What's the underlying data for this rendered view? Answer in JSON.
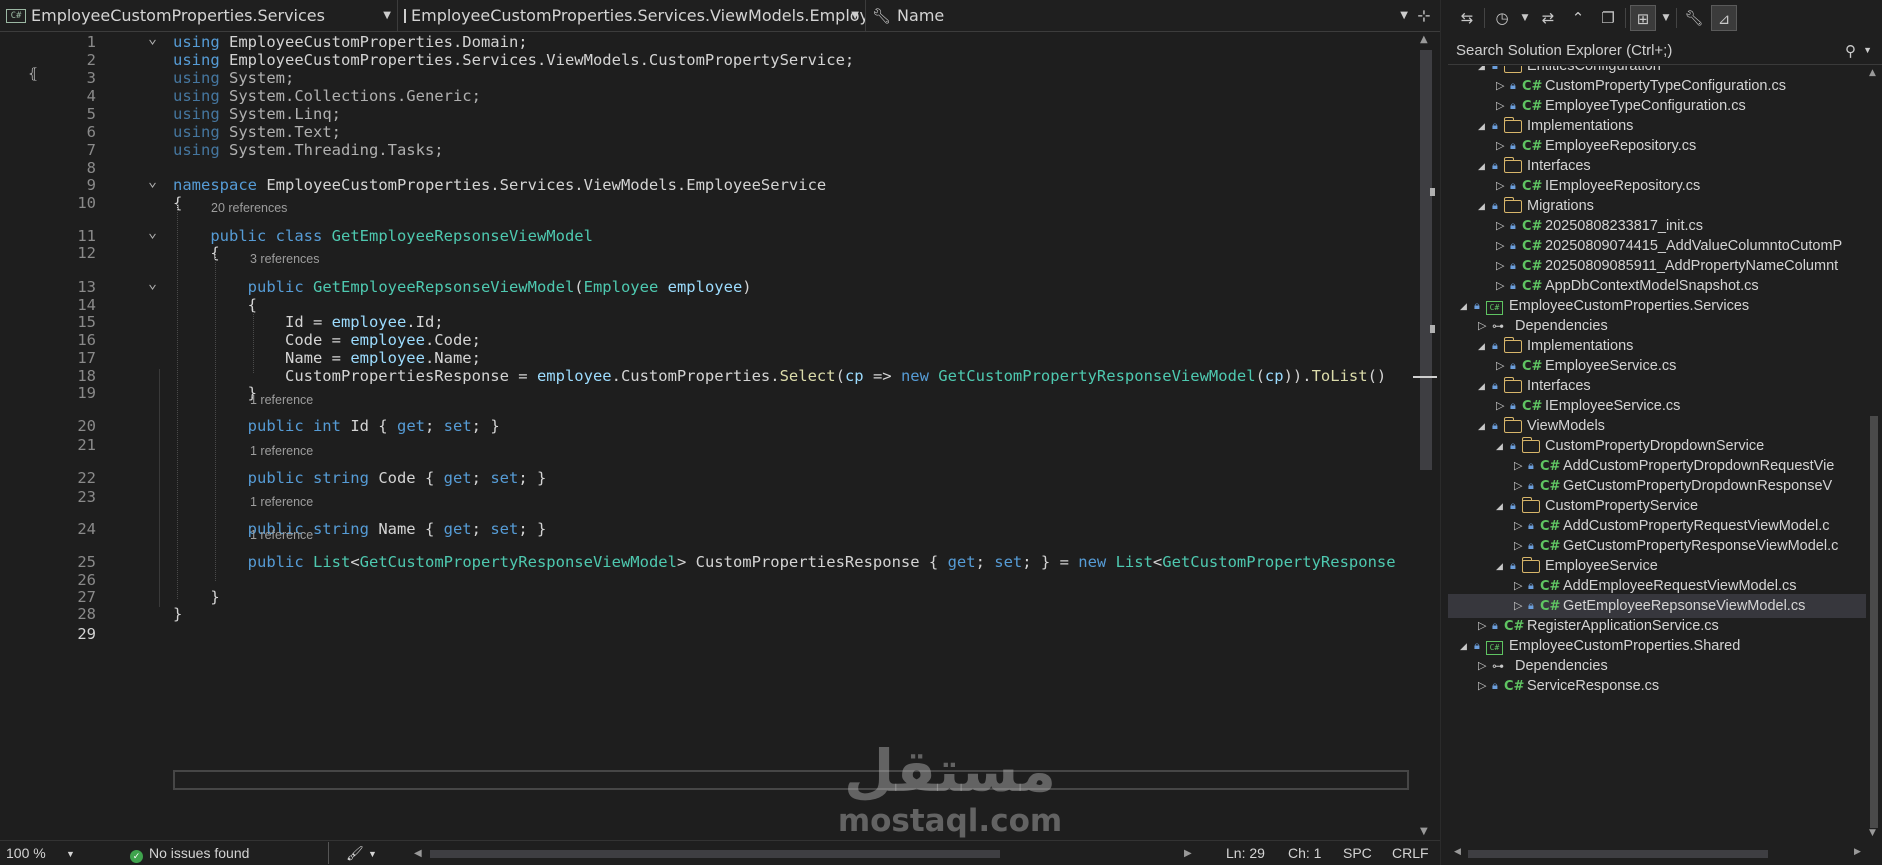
{
  "navbar": {
    "project": "EmployeeCustomProperties.Services",
    "type": "EmployeeCustomProperties.Services.ViewModels.EmployeeServi",
    "member": "Name",
    "project_badge": "C#"
  },
  "code_lines": [
    {
      "n": "1",
      "tokens": [
        [
          "kw",
          "using"
        ],
        [
          "pl",
          " EmployeeCustomProperties.Domain;"
        ]
      ]
    },
    {
      "n": "2",
      "tokens": [
        [
          "kw",
          "using"
        ],
        [
          "pl",
          " EmployeeCustomProperties.Services.ViewModels.CustomPropertyService;"
        ]
      ]
    },
    {
      "n": "3",
      "tokens": [
        [
          "kwd",
          "using"
        ],
        [
          "dim",
          " System;"
        ]
      ]
    },
    {
      "n": "4",
      "tokens": [
        [
          "kwd",
          "using"
        ],
        [
          "dim",
          " System.Collections.Generic;"
        ]
      ]
    },
    {
      "n": "5",
      "tokens": [
        [
          "kwd",
          "using"
        ],
        [
          "dim",
          " System.Linq;"
        ]
      ]
    },
    {
      "n": "6",
      "tokens": [
        [
          "kwd",
          "using"
        ],
        [
          "dim",
          " System.Text;"
        ]
      ]
    },
    {
      "n": "7",
      "tokens": [
        [
          "kwd",
          "using"
        ],
        [
          "dim",
          " System.Threading.Tasks;"
        ]
      ]
    },
    {
      "n": "8",
      "tokens": []
    },
    {
      "n": "9",
      "tokens": [
        [
          "kw",
          "namespace"
        ],
        [
          "pl",
          " EmployeeCustomProperties.Services.ViewModels.EmployeeService"
        ]
      ]
    },
    {
      "n": "10",
      "tokens": [
        [
          "pl",
          "{"
        ]
      ]
    },
    {
      "n": "11",
      "tokens": [
        [
          "pl",
          "    "
        ],
        [
          "kw",
          "public class"
        ],
        [
          "pl",
          " "
        ],
        [
          "ty",
          "GetEmployeeRepsonseViewModel"
        ]
      ]
    },
    {
      "n": "12",
      "tokens": [
        [
          "pl",
          "    {"
        ]
      ]
    },
    {
      "n": "13",
      "tokens": [
        [
          "pl",
          "        "
        ],
        [
          "kw",
          "public"
        ],
        [
          "pl",
          " "
        ],
        [
          "ty",
          "GetEmployeeRepsonseViewModel"
        ],
        [
          "pl",
          "("
        ],
        [
          "ty",
          "Employee"
        ],
        [
          "pl",
          " "
        ],
        [
          "id",
          "employee"
        ],
        [
          "pl",
          ")"
        ]
      ]
    },
    {
      "n": "14",
      "tokens": [
        [
          "pl",
          "        {"
        ]
      ]
    },
    {
      "n": "15",
      "tokens": [
        [
          "pl",
          "            Id = "
        ],
        [
          "id",
          "employee"
        ],
        [
          "pl",
          ".Id;"
        ]
      ]
    },
    {
      "n": "16",
      "tokens": [
        [
          "pl",
          "            Code = "
        ],
        [
          "id",
          "employee"
        ],
        [
          "pl",
          ".Code;"
        ]
      ]
    },
    {
      "n": "17",
      "tokens": [
        [
          "pl",
          "            Name = "
        ],
        [
          "id",
          "employee"
        ],
        [
          "pl",
          ".Name;"
        ]
      ]
    },
    {
      "n": "18",
      "tokens": [
        [
          "pl",
          "            CustomPropertiesResponse = "
        ],
        [
          "id",
          "employee"
        ],
        [
          "pl",
          ".CustomProperties."
        ],
        [
          "fn",
          "Select"
        ],
        [
          "pl",
          "("
        ],
        [
          "id",
          "cp"
        ],
        [
          "pl",
          " => "
        ],
        [
          "kw",
          "new"
        ],
        [
          "pl",
          " "
        ],
        [
          "ty",
          "GetCustomPropertyResponseViewModel"
        ],
        [
          "pl",
          "("
        ],
        [
          "id",
          "cp"
        ],
        [
          "pl",
          "))."
        ],
        [
          "fn",
          "ToList"
        ],
        [
          "pl",
          "()"
        ]
      ]
    },
    {
      "n": "19",
      "tokens": [
        [
          "pl",
          "        }"
        ]
      ]
    },
    {
      "n": "20",
      "tokens": [
        [
          "pl",
          "        "
        ],
        [
          "kw",
          "public int"
        ],
        [
          "pl",
          " Id { "
        ],
        [
          "kw",
          "get"
        ],
        [
          "pl",
          "; "
        ],
        [
          "kw",
          "set"
        ],
        [
          "pl",
          "; }"
        ]
      ]
    },
    {
      "n": "21",
      "tokens": []
    },
    {
      "n": "22",
      "tokens": [
        [
          "pl",
          "        "
        ],
        [
          "kw",
          "public string"
        ],
        [
          "pl",
          " Code { "
        ],
        [
          "kw",
          "get"
        ],
        [
          "pl",
          "; "
        ],
        [
          "kw",
          "set"
        ],
        [
          "pl",
          "; }"
        ]
      ]
    },
    {
      "n": "23",
      "tokens": []
    },
    {
      "n": "24",
      "tokens": [
        [
          "pl",
          "        "
        ],
        [
          "kw",
          "public string"
        ],
        [
          "pl",
          " Name { "
        ],
        [
          "kw",
          "get"
        ],
        [
          "pl",
          "; "
        ],
        [
          "kw",
          "set"
        ],
        [
          "pl",
          "; }"
        ]
      ]
    },
    {
      "n": "25",
      "tokens": [
        [
          "pl",
          "        "
        ],
        [
          "kw",
          "public"
        ],
        [
          "pl",
          " "
        ],
        [
          "ty",
          "List"
        ],
        [
          "pl",
          "<"
        ],
        [
          "ty",
          "GetCustomPropertyResponseViewModel"
        ],
        [
          "pl",
          "> CustomPropertiesResponse { "
        ],
        [
          "kw",
          "get"
        ],
        [
          "pl",
          "; "
        ],
        [
          "kw",
          "set"
        ],
        [
          "pl",
          "; } = "
        ],
        [
          "kw",
          "new"
        ],
        [
          "pl",
          " "
        ],
        [
          "ty",
          "List"
        ],
        [
          "pl",
          "<"
        ],
        [
          "ty",
          "GetCustomPropertyResponse"
        ]
      ]
    },
    {
      "n": "26",
      "tokens": []
    },
    {
      "n": "27",
      "tokens": [
        [
          "pl",
          "    }"
        ]
      ]
    },
    {
      "n": "28",
      "tokens": [
        [
          "pl",
          "}"
        ]
      ]
    },
    {
      "n": "29",
      "tokens": []
    }
  ],
  "codelens": {
    "l11": "20 references",
    "l13": "3 references",
    "l20": "1 reference",
    "l22": "1 reference",
    "l24": "1 reference",
    "l25": "1 reference"
  },
  "status": {
    "zoom": "100 %",
    "issues": "No issues found",
    "ln": "Ln: 29",
    "ch": "Ch: 1",
    "spc": "SPC",
    "eol": "CRLF"
  },
  "watermark": {
    "arabic": "مستقل",
    "latin": "mostaql.com"
  },
  "solution_explorer": {
    "search_placeholder": "Search Solution Explorer (Ctrl+;)",
    "items": [
      {
        "label": "EntitiesConfiguration",
        "kind": "folder",
        "depth": 2,
        "expanded": true
      },
      {
        "label": "CustomPropertyTypeConfiguration.cs",
        "kind": "cs",
        "depth": 3
      },
      {
        "label": "EmployeeTypeConfiguration.cs",
        "kind": "cs",
        "depth": 3
      },
      {
        "label": "Implementations",
        "kind": "folder",
        "depth": 2,
        "expanded": true
      },
      {
        "label": "EmployeeRepository.cs",
        "kind": "cs",
        "depth": 3
      },
      {
        "label": "Interfaces",
        "kind": "folder",
        "depth": 2,
        "expanded": true
      },
      {
        "label": "IEmployeeRepository.cs",
        "kind": "cs",
        "depth": 3
      },
      {
        "label": "Migrations",
        "kind": "folder",
        "depth": 2,
        "expanded": true
      },
      {
        "label": "20250808233817_init.cs",
        "kind": "cs",
        "depth": 3
      },
      {
        "label": "20250809074415_AddValueColumntoCutomP",
        "kind": "cs",
        "depth": 3
      },
      {
        "label": "20250809085911_AddPropertyNameColumnt",
        "kind": "cs",
        "depth": 3
      },
      {
        "label": "AppDbContextModelSnapshot.cs",
        "kind": "cs",
        "depth": 3
      },
      {
        "label": "EmployeeCustomProperties.Services",
        "kind": "project",
        "depth": 1,
        "expanded": true
      },
      {
        "label": "Dependencies",
        "kind": "deps",
        "depth": 2
      },
      {
        "label": "Implementations",
        "kind": "folder",
        "depth": 2,
        "expanded": true
      },
      {
        "label": "EmployeeService.cs",
        "kind": "cs",
        "depth": 3
      },
      {
        "label": "Interfaces",
        "kind": "folder",
        "depth": 2,
        "expanded": true
      },
      {
        "label": "IEmployeeService.cs",
        "kind": "cs",
        "depth": 3
      },
      {
        "label": "ViewModels",
        "kind": "folder",
        "depth": 2,
        "expanded": true
      },
      {
        "label": "CustomPropertyDropdownService",
        "kind": "folder",
        "depth": 3,
        "expanded": true
      },
      {
        "label": "AddCustomPropertyDropdownRequestVie",
        "kind": "cs",
        "depth": 4
      },
      {
        "label": "GetCustomPropertyDropdownResponseV",
        "kind": "cs",
        "depth": 4
      },
      {
        "label": "CustomPropertyService",
        "kind": "folder",
        "depth": 3,
        "expanded": true
      },
      {
        "label": "AddCustomPropertyRequestViewModel.c",
        "kind": "cs",
        "depth": 4
      },
      {
        "label": "GetCustomPropertyResponseViewModel.c",
        "kind": "cs",
        "depth": 4
      },
      {
        "label": "EmployeeService",
        "kind": "folder",
        "depth": 3,
        "expanded": true
      },
      {
        "label": "AddEmployeeRequestViewModel.cs",
        "kind": "cs",
        "depth": 4
      },
      {
        "label": "GetEmployeeRepsonseViewModel.cs",
        "kind": "cs",
        "depth": 4,
        "selected": true
      },
      {
        "label": "RegisterApplicationService.cs",
        "kind": "cs",
        "depth": 2
      },
      {
        "label": "EmployeeCustomProperties.Shared",
        "kind": "project",
        "depth": 1,
        "expanded": true
      },
      {
        "label": "Dependencies",
        "kind": "deps",
        "depth": 2
      },
      {
        "label": "ServiceResponse.cs",
        "kind": "cs",
        "depth": 2
      }
    ]
  },
  "colors": {
    "keyword": "#569cd6",
    "type": "#4ec9b0",
    "identifier": "#9cdcfe",
    "method": "#dcdcaa",
    "background": "#1e1e1e",
    "csharp_icon": "#5fc462",
    "folder_icon": "#d8b66a"
  }
}
